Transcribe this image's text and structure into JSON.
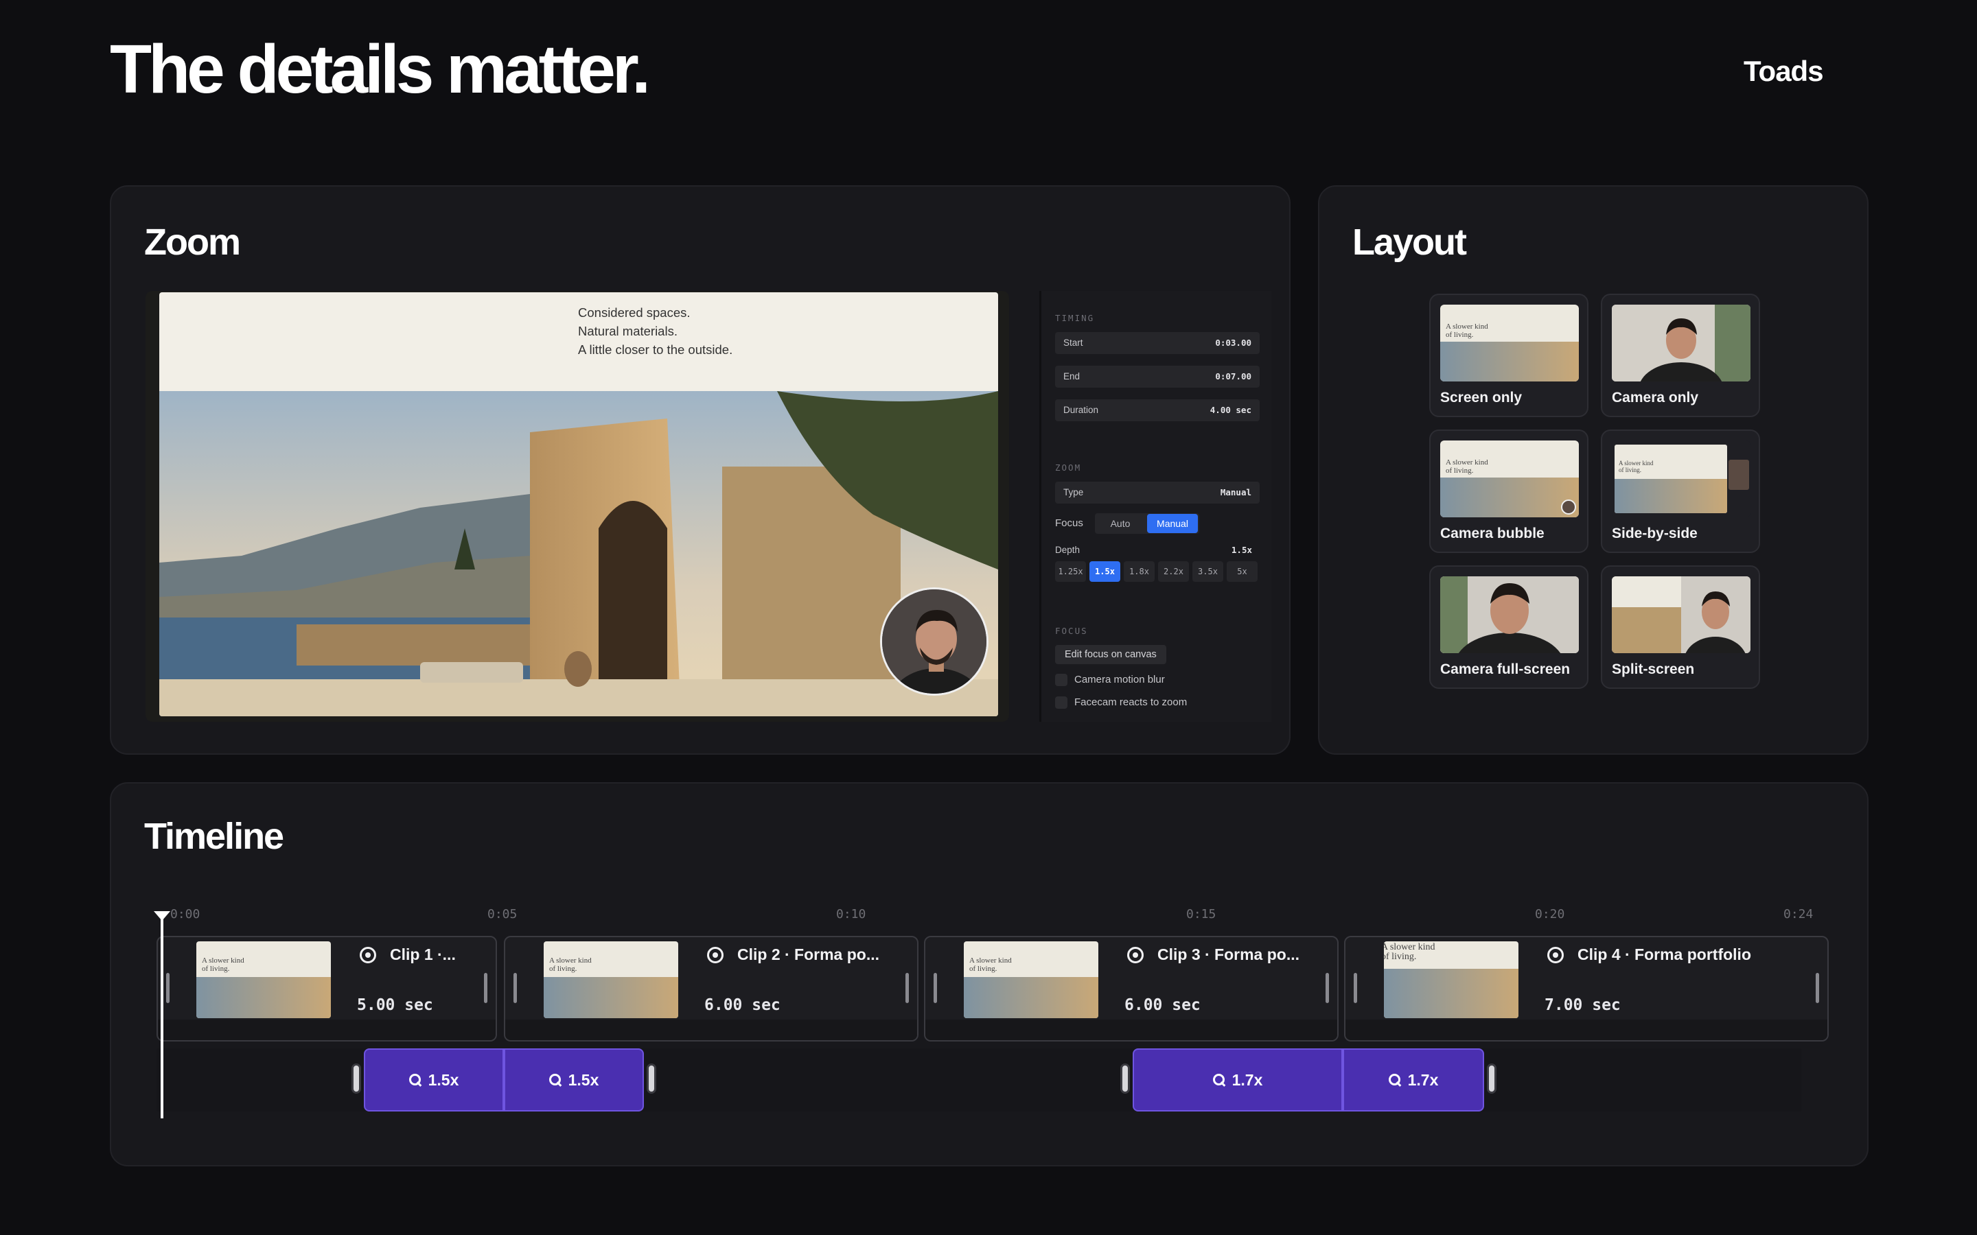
{
  "header": {
    "title": "The details matter.",
    "brand": "Toads"
  },
  "zoom": {
    "title": "Zoom",
    "canvas_text": [
      "Considered spaces.",
      "Natural materials.",
      "A little closer to the outside."
    ],
    "panel": {
      "timing_label": "TIMING",
      "start_label": "Start",
      "start_value": "0:03.00",
      "end_label": "End",
      "end_value": "0:07.00",
      "duration_label": "Duration",
      "duration_value": "4.00 sec",
      "zoom_label": "ZOOM",
      "type_label": "Type",
      "type_value": "Manual",
      "focus_label": "Focus",
      "focus_options": [
        "Auto",
        "Manual"
      ],
      "focus_selected": "Manual",
      "depth_label": "Depth",
      "depth_value": "1.5x",
      "depth_options": [
        "1.25x",
        "1.5x",
        "1.8x",
        "2.2x",
        "3.5x",
        "5x"
      ],
      "focus_section_label": "FOCUS",
      "edit_focus_button": "Edit focus on canvas",
      "motion_blur_label": "Camera motion blur",
      "facecam_label": "Facecam reacts to zoom"
    }
  },
  "layout": {
    "title": "Layout",
    "options": [
      "Screen only",
      "Camera only",
      "Camera bubble",
      "Side-by-side",
      "Camera full-screen",
      "Split-screen"
    ]
  },
  "timeline": {
    "title": "Timeline",
    "ticks": [
      "0:00",
      "0:05",
      "0:10",
      "0:15",
      "0:20",
      "0:24"
    ],
    "clips": [
      {
        "title": "Clip 1 ·...",
        "duration": "5.00 sec"
      },
      {
        "title": "Clip 2 · Forma po...",
        "duration": "6.00 sec"
      },
      {
        "title": "Clip 3 · Forma po...",
        "duration": "6.00 sec"
      },
      {
        "title": "Clip 4 · Forma portfolio",
        "duration": "7.00 sec"
      }
    ],
    "zoom_segments": [
      "1.5x",
      "1.5x",
      "1.7x",
      "1.7x"
    ]
  },
  "thumb_text": "A slower kind of living."
}
